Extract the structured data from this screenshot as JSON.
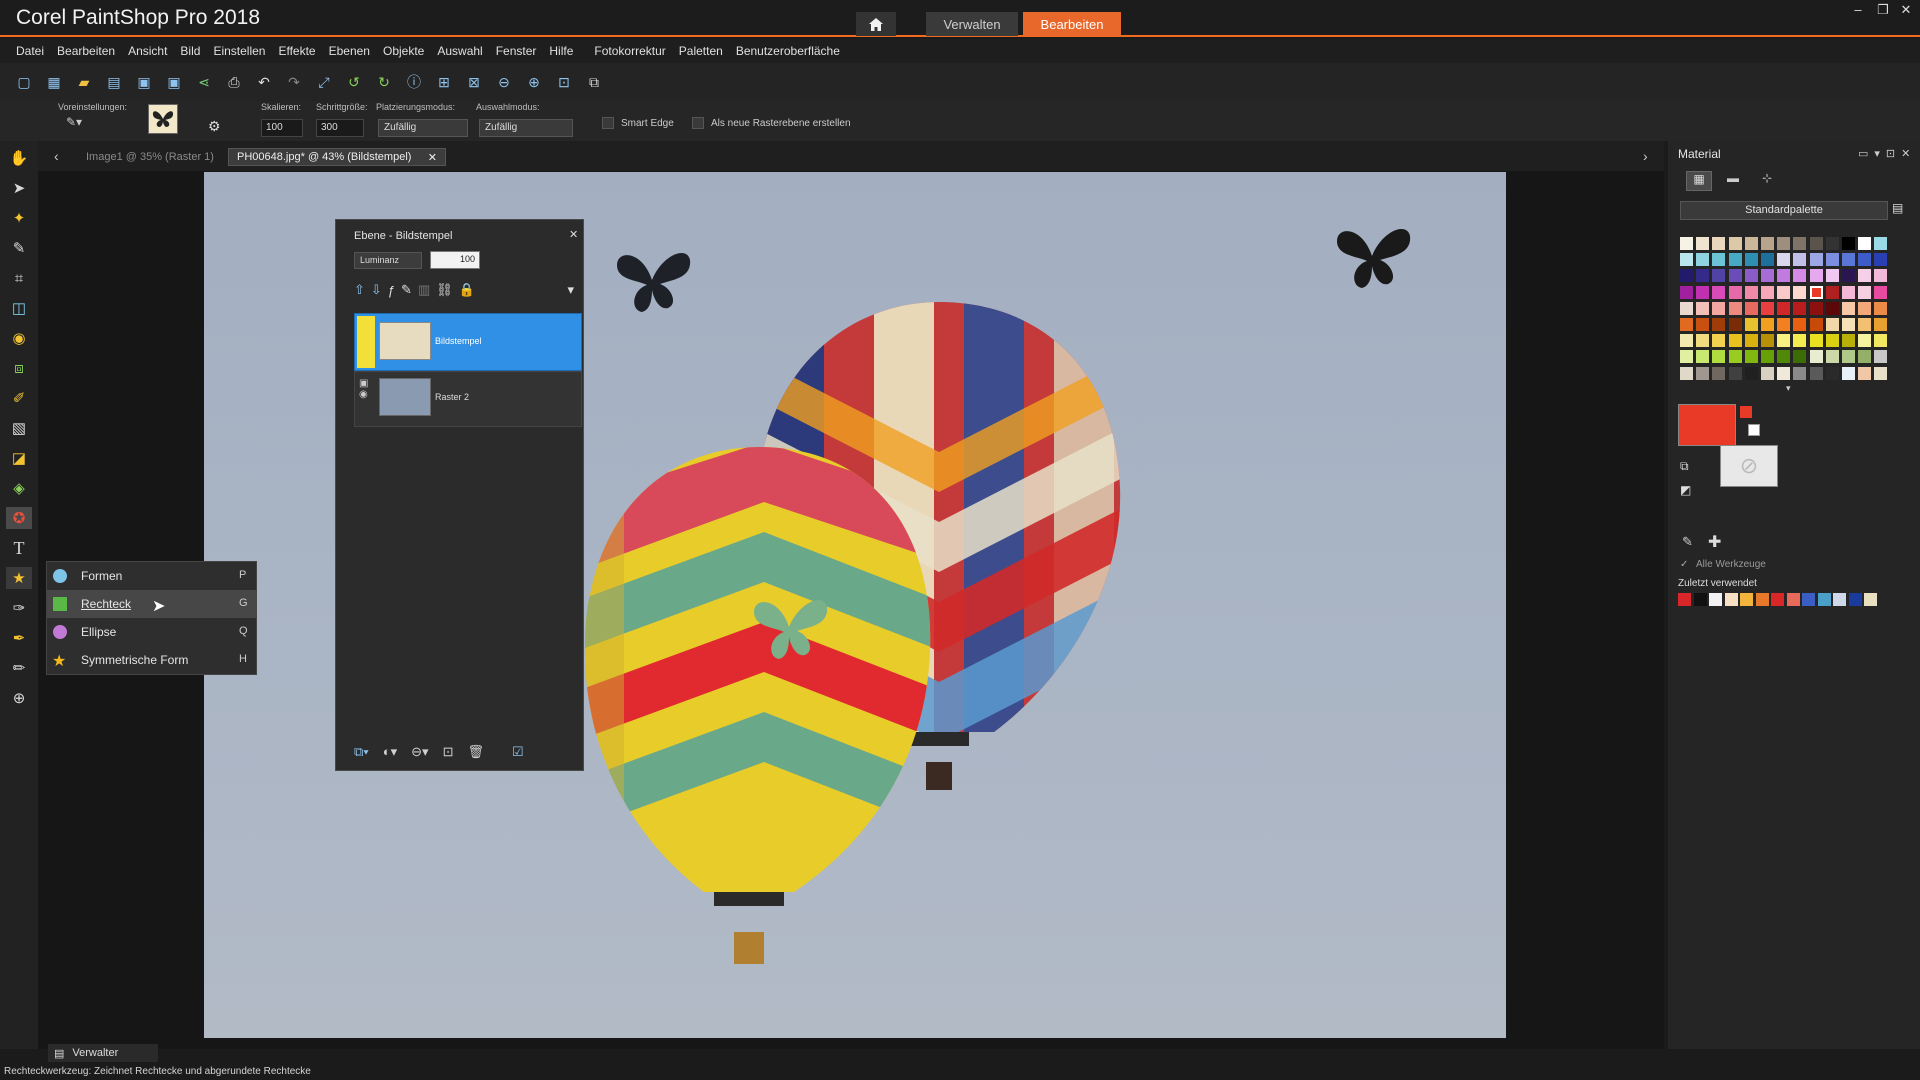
{
  "app": {
    "title": "Corel PaintShop Pro 2018"
  },
  "mode_tabs": {
    "manage": "Verwalten",
    "edit": "Bearbeiten"
  },
  "window_buttons": {
    "minimize": "–",
    "restore": "❐",
    "close": "✕"
  },
  "menu": [
    "Datei",
    "Bearbeiten",
    "Ansicht",
    "Bild",
    "Einstellen",
    "Effekte",
    "Ebenen",
    "Objekte",
    "Auswahl",
    "Fenster",
    "Hilfe",
    "Fotokorrektur",
    "Paletten",
    "Benutzeroberfläche"
  ],
  "options": {
    "presets_label": "Voreinstellungen:",
    "scale_label": "Skalieren:",
    "scale_value": "100",
    "step_label": "Schrittgröße:",
    "step_value": "300",
    "placement_label": "Platzierungsmodus:",
    "placement_value": "Zufällig",
    "selection_label": "Auswahlmodus:",
    "selection_value": "Zufällig",
    "smart_edge_label": "Smart Edge",
    "new_raster_label": "Als neue Rasterebene erstellen"
  },
  "doc_tabs": [
    {
      "label": "Image1 @  35% (Raster 1)"
    },
    {
      "label": "PH00648.jpg* @  43% (Bildstempel)"
    }
  ],
  "layers_panel": {
    "title": "Ebene - Bildstempel",
    "blend_mode": "Luminanz",
    "opacity": "100",
    "layers": [
      {
        "name": "Bildstempel",
        "selected": true
      },
      {
        "name": "Raster 2",
        "selected": false
      }
    ]
  },
  "shape_flyout": {
    "items": [
      {
        "label": "Formen",
        "shortcut": "P",
        "color": "#7cc4e8"
      },
      {
        "label": "Rechteck",
        "shortcut": "G",
        "color": "#59b846"
      },
      {
        "label": "Ellipse",
        "shortcut": "Q",
        "color": "#c27ad6"
      },
      {
        "label": "Symmetrische Form",
        "shortcut": "H",
        "color": "#f2b81c"
      }
    ]
  },
  "material_panel": {
    "title": "Material",
    "palette_name": "Standardpalette",
    "all_tools_label": "Alle Werkzeuge",
    "recent_label": "Zuletzt verwendet",
    "foreground_color": "#e83a27",
    "recent_colors": [
      "#d9262b",
      "#111111",
      "#f2f2f2",
      "#f7e0c4",
      "#f2b43a",
      "#e8792a",
      "#d92727",
      "#e86a5a",
      "#3a5ec4",
      "#4aa0c9",
      "#cfd8e8",
      "#1a3a9e",
      "#e8e0c0"
    ]
  },
  "bottom_tab": {
    "label": "Verwalter"
  },
  "status": {
    "text": "Rechteckwerkzeug: Zeichnet Rechtecke und abgerundete Rechtecke"
  }
}
